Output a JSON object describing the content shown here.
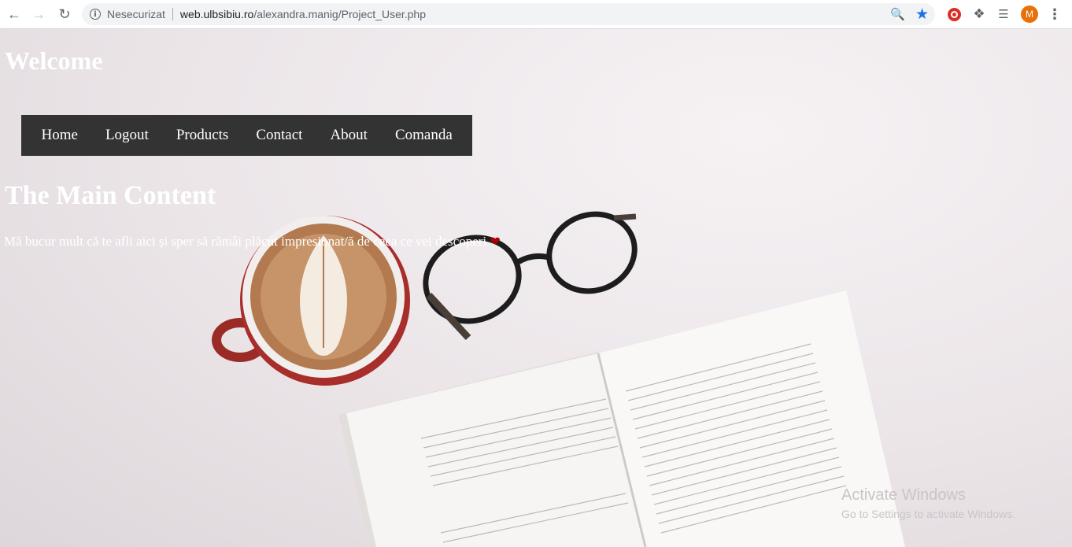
{
  "browser": {
    "security_label": "Nesecurizat",
    "url_host": "web.ulbsibiu.ro",
    "url_path": "/alexandra.manig/Project_User.php",
    "profile_initial": "M"
  },
  "page": {
    "welcome": "Welcome",
    "nav": [
      {
        "label": "Home"
      },
      {
        "label": "Logout"
      },
      {
        "label": "Products"
      },
      {
        "label": "Contact"
      },
      {
        "label": "About"
      },
      {
        "label": "Comanda"
      }
    ],
    "main_title": "The Main Content",
    "tagline": "Mă bucur mult că te afli aici și sper să rămâi plăcut impresionat/ă de ceea ce vei descoperi"
  },
  "windows_watermark": {
    "title": "Activate Windows",
    "subtitle": "Go to Settings to activate Windows."
  },
  "colors": {
    "navbar_bg": "#333333",
    "heart": "#b00000",
    "star": "#1a73e8",
    "avatar": "#e8710a"
  }
}
